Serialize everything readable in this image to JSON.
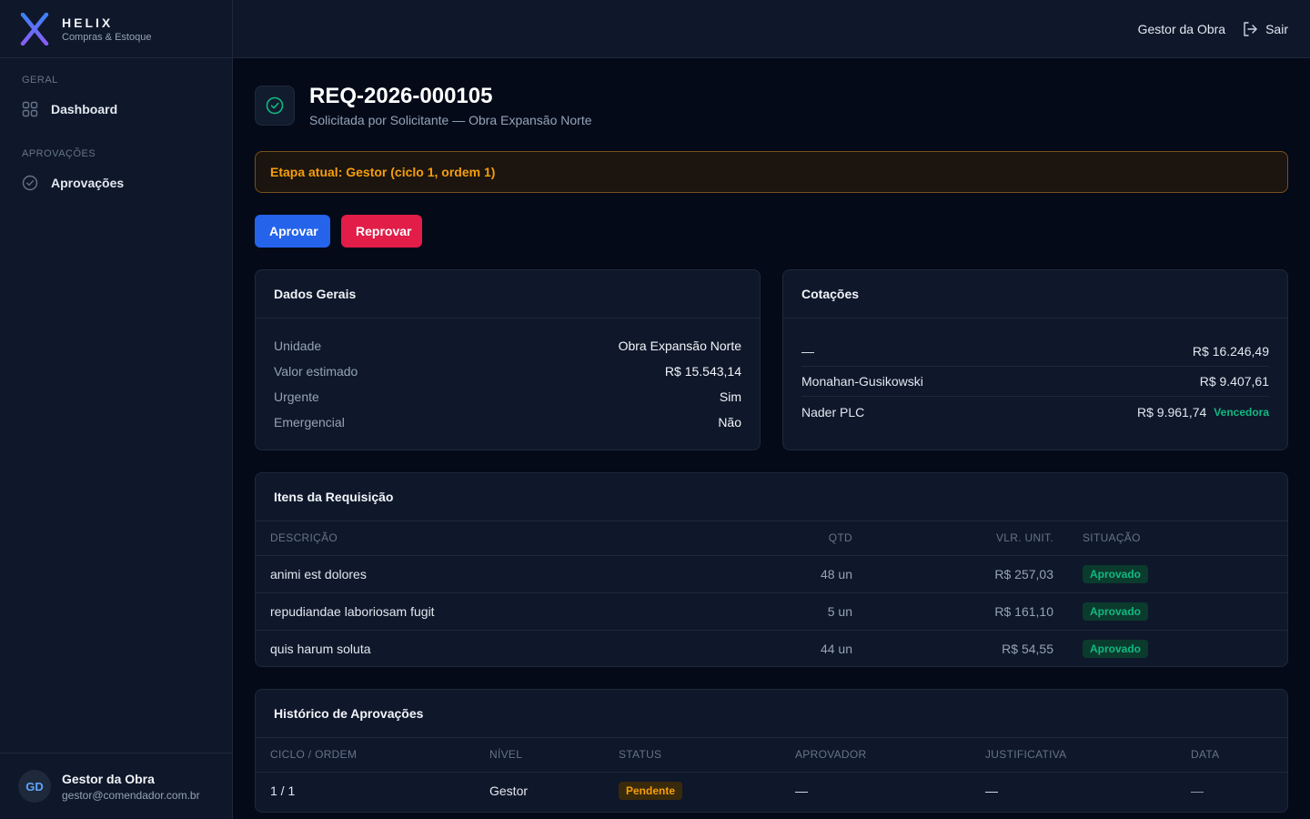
{
  "brand": {
    "name": "HELIX",
    "subtitle": "Compras & Estoque"
  },
  "sidebar": {
    "sections": [
      {
        "heading": "GERAL",
        "items": [
          {
            "label": "Dashboard",
            "icon": "grid-icon"
          }
        ]
      },
      {
        "heading": "APROVAÇÕES",
        "items": [
          {
            "label": "Aprovações",
            "icon": "check-circle-icon"
          }
        ]
      }
    ],
    "user": {
      "initials": "GD",
      "name": "Gestor da Obra",
      "email": "gestor@comendador.com.br"
    }
  },
  "topbar": {
    "user_label": "Gestor da Obra",
    "logout_label": "Sair"
  },
  "requisition": {
    "code": "REQ-2026-000105",
    "subtitle": "Solicitada por Solicitante — Obra Expansão Norte",
    "stage_prefix": "Etapa atual:",
    "stage_level": "Gestor",
    "stage_suffix": "(ciclo 1, ordem 1)"
  },
  "actions": {
    "approve_label": "Aprovar",
    "reject_label": "Reprovar"
  },
  "general": {
    "title": "Dados Gerais",
    "rows": [
      {
        "key": "Unidade",
        "value": "Obra Expansão Norte"
      },
      {
        "key": "Valor estimado",
        "value": "R$ 15.543,14"
      },
      {
        "key": "Urgente",
        "value": "Sim"
      },
      {
        "key": "Emergencial",
        "value": "Não"
      }
    ]
  },
  "quotes": {
    "title": "Cotações",
    "rows": [
      {
        "supplier": "—",
        "value": "R$ 16.246,49",
        "tag": ""
      },
      {
        "supplier": "Monahan-Gusikowski",
        "value": "R$ 9.407,61",
        "tag": ""
      },
      {
        "supplier": "Nader PLC",
        "value": "R$ 9.961,74",
        "tag": "Vencedora"
      }
    ]
  },
  "items": {
    "title": "Itens da Requisição",
    "columns": [
      "DESCRIÇÃO",
      "QTD",
      "VLR. UNIT.",
      "SITUAÇÃO"
    ],
    "rows": [
      {
        "description": "animi est dolores",
        "qty": "48 un",
        "unit_price": "R$ 257,03",
        "status": "Aprovado"
      },
      {
        "description": "repudiandae laboriosam fugit",
        "qty": "5 un",
        "unit_price": "R$ 161,10",
        "status": "Aprovado"
      },
      {
        "description": "quis harum soluta",
        "qty": "44 un",
        "unit_price": "R$ 54,55",
        "status": "Aprovado"
      }
    ]
  },
  "history": {
    "title": "Histórico de Aprovações",
    "columns": [
      "CICLO / ORDEM",
      "NÍVEL",
      "STATUS",
      "APROVADOR",
      "JUSTIFICATIVA",
      "DATA"
    ],
    "rows": [
      {
        "cycle_order": "1 / 1",
        "level": "Gestor",
        "status": "Pendente",
        "approver": "—",
        "justification": "—",
        "date": "—"
      }
    ]
  },
  "colors": {
    "accent": "#2563eb",
    "danger": "#e11d48",
    "success": "#10b981",
    "warning": "#f59e0b"
  }
}
